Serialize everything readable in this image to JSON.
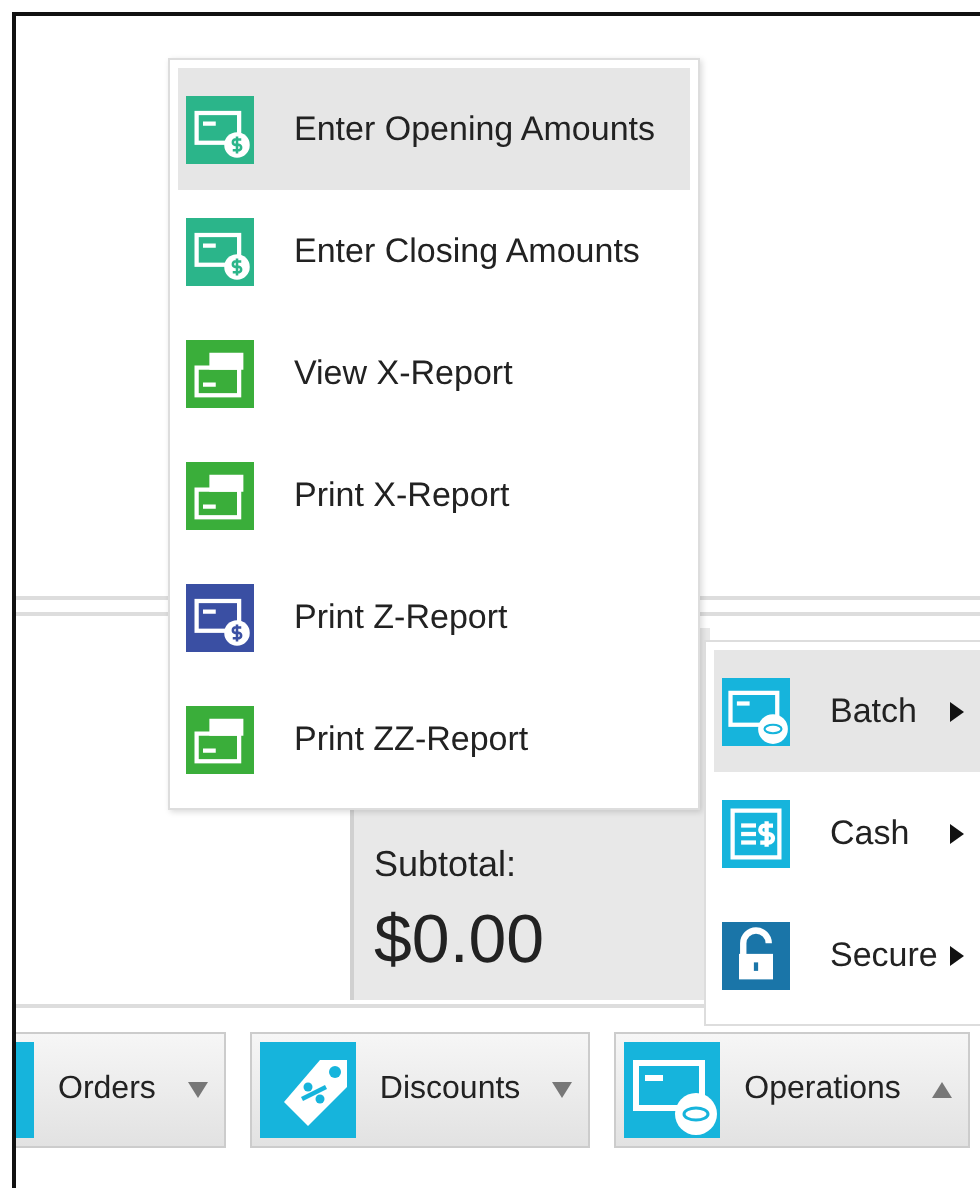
{
  "menu": {
    "items": [
      {
        "label": "Enter Opening Amounts",
        "selected": true,
        "kind": "cash-card",
        "color": "#2bb58a"
      },
      {
        "label": "Enter Closing Amounts",
        "selected": false,
        "kind": "cash-card",
        "color": "#2bb58a"
      },
      {
        "label": "View X-Report",
        "selected": false,
        "kind": "banknote-card",
        "color": "#3aae3a"
      },
      {
        "label": "Print X-Report",
        "selected": false,
        "kind": "banknote-card",
        "color": "#3aae3a"
      },
      {
        "label": "Print Z-Report",
        "selected": false,
        "kind": "cash-card",
        "color": "#3a4fa3"
      },
      {
        "label": "Print ZZ-Report",
        "selected": false,
        "kind": "banknote-card",
        "color": "#3aae3a"
      }
    ]
  },
  "submenu": {
    "items": [
      {
        "label": "Batch",
        "selected": true,
        "kind": "card-coins",
        "color": "#16b4dc"
      },
      {
        "label": "Cash",
        "selected": false,
        "kind": "cash-sheet",
        "color": "#16b4dc"
      },
      {
        "label": "Secure",
        "selected": false,
        "kind": "padlock",
        "color": "#1a75a8"
      }
    ]
  },
  "totals": {
    "label": "Subtotal:",
    "amount": "$0.00"
  },
  "toolbar": {
    "buttons": [
      {
        "label": "Orders",
        "expanded": false,
        "kind": "none"
      },
      {
        "label": "Discounts",
        "expanded": false,
        "kind": "tag"
      },
      {
        "label": "Operations",
        "expanded": true,
        "kind": "card-coins"
      }
    ]
  }
}
